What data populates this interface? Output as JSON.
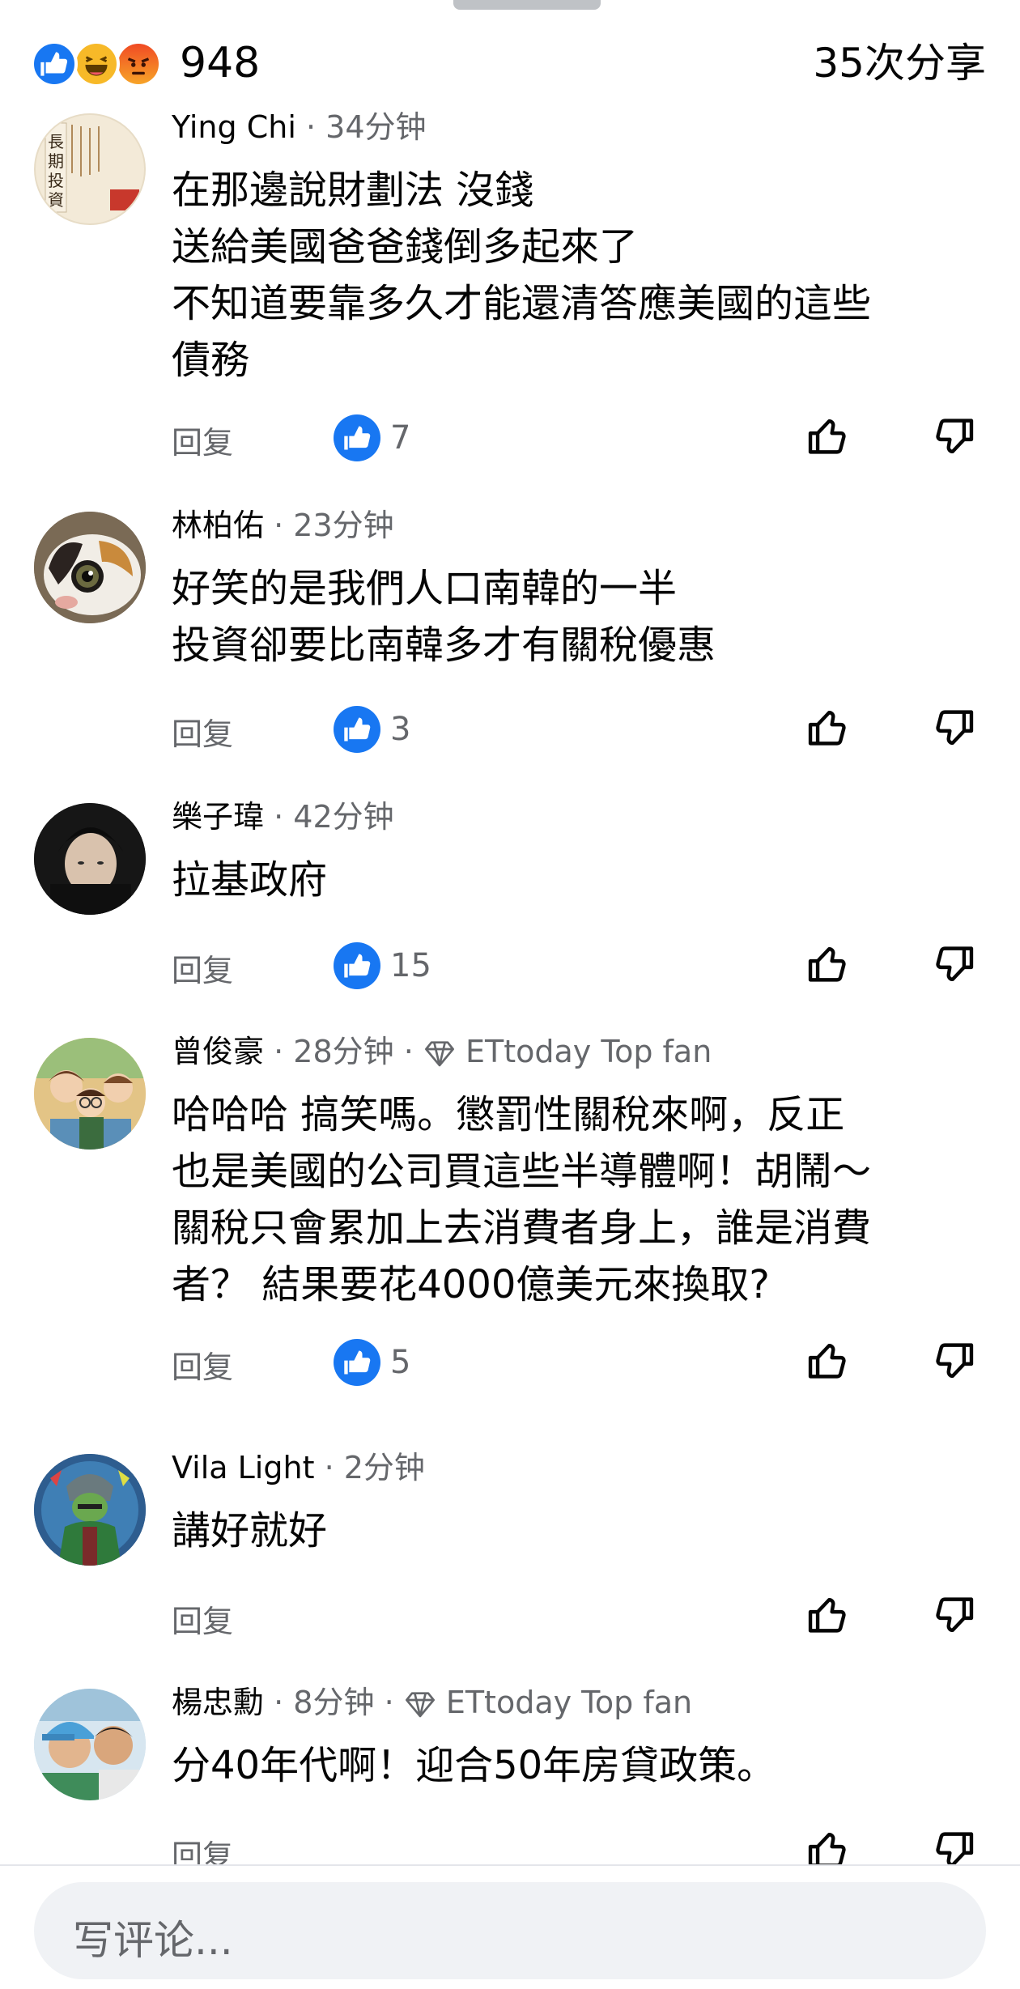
{
  "header": {
    "reaction_icons": [
      "like-icon",
      "haha-icon",
      "angry-icon"
    ],
    "reaction_count": "948",
    "share_count": "35次分享"
  },
  "comments": [
    {
      "author": "Ying Chi",
      "time": "34分钟",
      "badge": "",
      "lines": [
        "在那邊說財劃法 沒錢",
        "送給美國爸爸錢倒多起來了",
        "不知道要靠多久才能還清答應美國的這些",
        "債務"
      ],
      "likes": "7",
      "reply": "回复",
      "avatar_text": [
        "長",
        "期",
        "投",
        "資"
      ]
    },
    {
      "author": "林柏佑",
      "time": "23分钟",
      "badge": "",
      "lines": [
        "好笑的是我們人口南韓的一半",
        "投資卻要比南韓多才有關稅優惠"
      ],
      "likes": "3",
      "reply": "回复"
    },
    {
      "author": "樂子瑋",
      "time": "42分钟",
      "badge": "",
      "lines": [
        "拉基政府"
      ],
      "likes": "15",
      "reply": "回复"
    },
    {
      "author": "曾俊豪",
      "time": "28分钟",
      "badge": "ETtoday Top fan",
      "lines": [
        "哈哈哈 搞笑嗎。懲罰性關稅來啊，反正",
        "也是美國的公司買這些半導體啊！胡鬧～",
        "關稅只會累加上去消費者身上，誰是消費",
        "者？ 結果要花4000億美元來換取?"
      ],
      "likes": "5",
      "reply": "回复"
    },
    {
      "author": "Vila Light",
      "time": "2分钟",
      "badge": "",
      "lines": [
        "講好就好"
      ],
      "likes": "",
      "reply": "回复"
    },
    {
      "author": "楊忠勳",
      "time": "8分钟",
      "badge": "ETtoday Top fan",
      "lines": [
        "分40年代啊！迎合50年房貸政策。"
      ],
      "likes": "",
      "reply": "回复"
    }
  ],
  "composer": {
    "placeholder": "写评论..."
  },
  "colors": {
    "accent": "#1877f2",
    "secondary_text": "#65676b",
    "input_bg": "#f0f2f5"
  }
}
